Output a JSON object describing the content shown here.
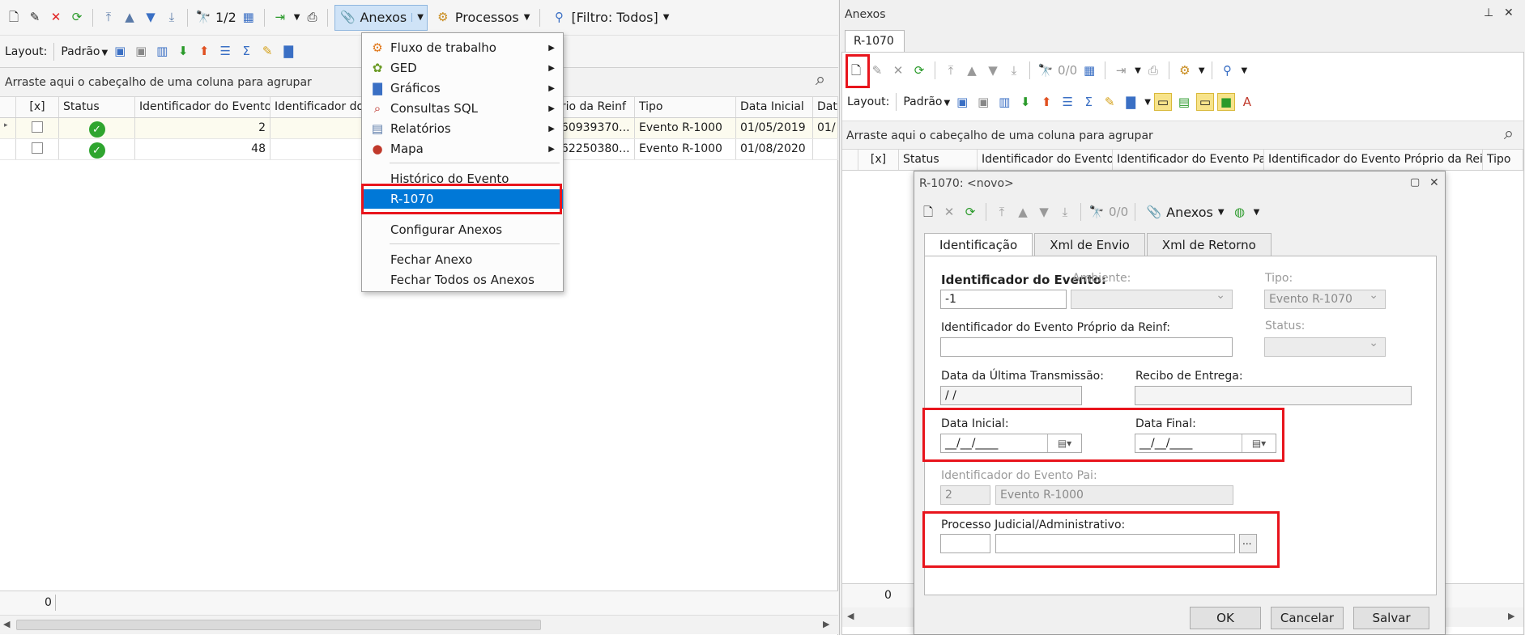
{
  "left": {
    "toolbar": {
      "counter": "1/2",
      "anexos_label": "Anexos",
      "processos_label": "Processos",
      "filtro_label": "[Filtro: Todos]"
    },
    "toolbar2": {
      "layout_label": "Layout:",
      "padrao_label": "Padrão"
    },
    "group_hint": "Arraste aqui o cabeçalho de uma coluna para agrupar",
    "columns": [
      "[x]",
      "Status",
      "Identificador do Evento",
      "Identificador do E",
      "prio da Reinf",
      "Tipo",
      "Data Inicial",
      "Dat"
    ],
    "rows": [
      {
        "id": "2",
        "reinf": "060939370...",
        "tipo": "Evento R-1000",
        "data": "01/05/2019",
        "dat": "01/"
      },
      {
        "id": "48",
        "reinf": "162250380...",
        "tipo": "Evento R-1000",
        "data": "01/08/2020",
        "dat": ""
      }
    ],
    "footer_count": "0"
  },
  "menu": {
    "items": [
      {
        "label": "Fluxo de trabalho",
        "icon": "workflow-icon",
        "glyph": "⚙",
        "color": "#e0771a",
        "submenu": true
      },
      {
        "label": "GED",
        "icon": "ged-icon",
        "glyph": "✿",
        "color": "#6a9a24",
        "submenu": true
      },
      {
        "label": "Gráficos",
        "icon": "chart-icon",
        "glyph": "▇",
        "color": "#3a6fc4",
        "submenu": true
      },
      {
        "label": "Consultas SQL",
        "icon": "sql-query-icon",
        "glyph": "🔍",
        "color": "#b8261e",
        "submenu": true
      },
      {
        "label": "Relatórios",
        "icon": "report-icon",
        "glyph": "▤",
        "color": "#5a7aa8",
        "submenu": true
      },
      {
        "label": "Mapa",
        "icon": "map-pin-icon",
        "glyph": "📍",
        "color": "#c0392b",
        "submenu": true
      },
      {
        "label": "Histórico do Evento"
      },
      {
        "label": "R-1070"
      },
      {
        "label": "Configurar Anexos"
      },
      {
        "label": "Fechar Anexo"
      },
      {
        "label": "Fechar Todos os Anexos"
      }
    ]
  },
  "right": {
    "title": "Anexos",
    "tab": "R-1070",
    "counter": "0/0",
    "layout_label": "Layout:",
    "padrao_label": "Padrão",
    "group_hint": "Arraste aqui o cabeçalho de uma coluna para agrupar",
    "columns": [
      "[x]",
      "Status",
      "Identificador do Evento",
      "Identificador do Evento Pai",
      "Identificador do Evento Próprio da Reinf",
      "Tipo"
    ],
    "footer_count": "0"
  },
  "dialog": {
    "title": "R-1070: <novo>",
    "counter": "0/0",
    "anexos_label": "Anexos",
    "tabs": [
      "Identificação",
      "Xml de Envio",
      "Xml de Retorno"
    ],
    "fields": {
      "id_evento_label": "Identificador do Evento:",
      "id_evento_value": "-1",
      "ambiente_label": "Ambiente:",
      "tipo_label": "Tipo:",
      "tipo_value": "Evento R-1070",
      "id_proprio_label": "Identificador do Evento Próprio da Reinf:",
      "status_label": "Status:",
      "data_transmissao_label": "Data da Última Transmissão:",
      "data_transmissao_value": " / /",
      "recibo_label": "Recibo de Entrega:",
      "data_inicial_label": "Data Inicial:",
      "data_inicial_value": "__/__/____",
      "data_final_label": "Data Final:",
      "data_final_value": "__/__/____",
      "id_pai_label": "Identificador do Evento Pai:",
      "id_pai_value": "2",
      "id_pai_desc": "Evento R-1000",
      "processo_label": "Processo Judicial/Administrativo:",
      "processo_btn": "..."
    },
    "buttons": {
      "ok": "OK",
      "cancel": "Cancelar",
      "save": "Salvar"
    }
  },
  "colors": {
    "highlight": "#0078d7",
    "annotation_red": "#e8141c",
    "status_green": "#2fa52f"
  }
}
